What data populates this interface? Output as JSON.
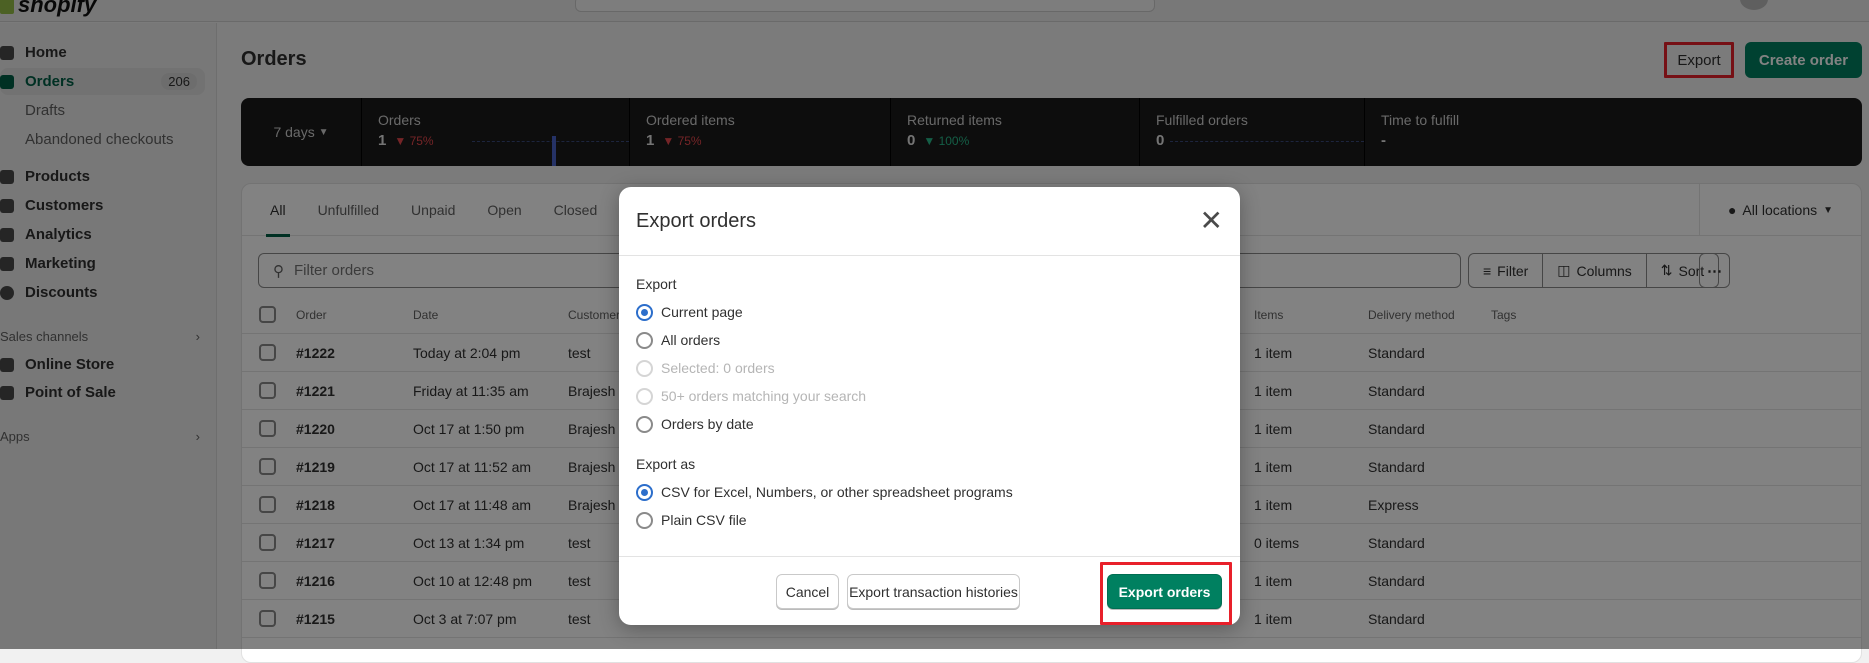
{
  "app": {
    "logo": "shopify"
  },
  "sidebar": {
    "items": [
      {
        "label": "Home",
        "icon": "home-icon"
      },
      {
        "label": "Orders",
        "icon": "inbox-icon",
        "badge": "206",
        "active": true
      },
      {
        "label": "Drafts"
      },
      {
        "label": "Abandoned checkouts"
      },
      {
        "label": "Products",
        "icon": "tag-icon"
      },
      {
        "label": "Customers",
        "icon": "person-icon"
      },
      {
        "label": "Analytics",
        "icon": "bar-chart-icon"
      },
      {
        "label": "Marketing",
        "icon": "target-icon"
      },
      {
        "label": "Discounts",
        "icon": "discount-icon"
      }
    ],
    "sales_channels": {
      "label": "Sales channels",
      "items": [
        {
          "label": "Online Store",
          "icon": "store-icon"
        },
        {
          "label": "Point of Sale",
          "icon": "pos-bag-icon"
        }
      ]
    },
    "apps": {
      "label": "Apps"
    }
  },
  "header": {
    "title": "Orders",
    "export_label": "Export",
    "create_label": "Create order"
  },
  "metrics": {
    "range": "7 days",
    "items": [
      {
        "label": "Orders",
        "value": "1",
        "delta": "75%",
        "direction": "down",
        "color": "#e5484d"
      },
      {
        "label": "Ordered items",
        "value": "1",
        "delta": "75%",
        "direction": "down",
        "color": "#e5484d"
      },
      {
        "label": "Returned items",
        "value": "0",
        "delta": "100%",
        "direction": "down",
        "color": "#29b98a"
      },
      {
        "label": "Fulfilled orders",
        "value": "0",
        "delta": ""
      },
      {
        "label": "Time to fulfill",
        "value": "-",
        "delta": ""
      }
    ]
  },
  "tabs": [
    "All",
    "Unfulfilled",
    "Unpaid",
    "Open",
    "Closed"
  ],
  "locations": "All locations",
  "filter": {
    "placeholder": "Filter orders",
    "filter_label": "Filter",
    "columns_label": "Columns",
    "sort_label": "Sort"
  },
  "table": {
    "columns": [
      "Order",
      "Date",
      "Customer",
      "Items",
      "Delivery method",
      "Tags"
    ],
    "rows": [
      {
        "order": "#1222",
        "date": "Today at 2:04 pm",
        "customer": "test",
        "items": "1 item",
        "delivery": "Standard"
      },
      {
        "order": "#1221",
        "date": "Friday at 11:35 am",
        "customer": "Brajesh I",
        "items": "1 item",
        "delivery": "Standard"
      },
      {
        "order": "#1220",
        "date": "Oct 17 at 1:50 pm",
        "customer": "Brajesh I",
        "items": "1 item",
        "delivery": "Standard"
      },
      {
        "order": "#1219",
        "date": "Oct 17 at 11:52 am",
        "customer": "Brajesh I",
        "items": "1 item",
        "delivery": "Standard"
      },
      {
        "order": "#1218",
        "date": "Oct 17 at 11:48 am",
        "customer": "Brajesh I",
        "items": "1 item",
        "delivery": "Express"
      },
      {
        "order": "#1217",
        "date": "Oct 13 at 1:34 pm",
        "customer": "test",
        "items": "0 items",
        "delivery": "Standard"
      },
      {
        "order": "#1216",
        "date": "Oct 10 at 12:48 pm",
        "customer": "test",
        "items": "1 item",
        "delivery": "Standard"
      },
      {
        "order": "#1215",
        "date": "Oct 3 at 7:07 pm",
        "customer": "test",
        "items": "1 item",
        "delivery": "Standard"
      }
    ]
  },
  "modal": {
    "title": "Export orders",
    "export_label": "Export",
    "export_options": [
      {
        "label": "Current page",
        "selected": true,
        "disabled": false
      },
      {
        "label": "All orders",
        "selected": false,
        "disabled": false
      },
      {
        "label": "Selected: 0 orders",
        "selected": false,
        "disabled": true
      },
      {
        "label": "50+ orders matching your search",
        "selected": false,
        "disabled": true
      },
      {
        "label": "Orders by date",
        "selected": false,
        "disabled": false
      }
    ],
    "export_as_label": "Export as",
    "format_options": [
      {
        "label": "CSV for Excel, Numbers, or other spreadsheet programs",
        "selected": true
      },
      {
        "label": "Plain CSV file",
        "selected": false
      }
    ],
    "cancel_label": "Cancel",
    "transactions_label": "Export transaction histories",
    "submit_label": "Export orders"
  },
  "colors": {
    "accent": "#008060",
    "highlight": "#e8202a",
    "radio": "#2c6ecb"
  }
}
